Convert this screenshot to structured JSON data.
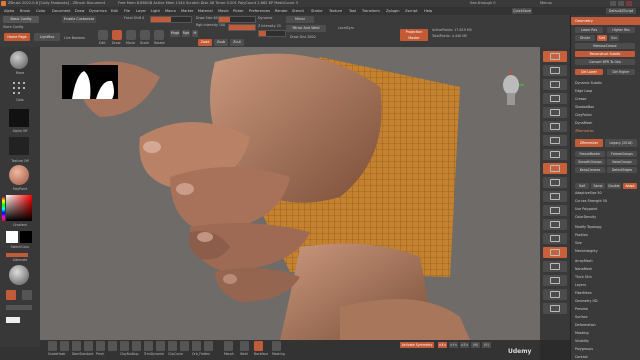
{
  "titlebar": {
    "app": "ZBrush 2022.0.6 [Cody Fanbooks] - ZBrush Document",
    "stats": "Free Mem 8.880GB  Active Mem 1344  Scratch Disk 48  Timer 0.001  PolyCount 2.662 KP  MeshCount 3",
    "quicksave": "QuickSave",
    "see_through": "See-through 0",
    "menus_label": "Menus",
    "default_script": "DefaultZScript"
  },
  "menus": [
    "Alpha",
    "Brush",
    "Color",
    "Document",
    "Draw",
    "Dynamics",
    "Edit",
    "File",
    "Layer",
    "Light",
    "Macro",
    "Marker",
    "Material",
    "Movie",
    "Picker",
    "Preferences",
    "Render",
    "Stencil",
    "Stroke",
    "Texture",
    "Tool",
    "Transform",
    "Zplugin",
    "Zscript",
    "Help"
  ],
  "toolbar": {
    "home_page": "Home Page",
    "lightbox": "LightBox",
    "live_boolean": "Live Boolean",
    "buttons": [
      "Edit",
      "Draw",
      "Move",
      "Scale",
      "Rotate"
    ],
    "mrgb": "Mrgb",
    "rgb": "Rgb",
    "m": "M",
    "zadd": "Zadd",
    "zsub": "Zsub",
    "zcut": "Zcut",
    "focal_shift": "Focal Shift 0",
    "draw_size": "Draw Size 64",
    "dynamic": "Dynamic",
    "rgb_intensity": "Rgb Intensity 100",
    "z_intensity": "Z Intensity 25",
    "mirror": "Mirror",
    "mirror_weld": "Mirror And Weld",
    "draw_dist": "Draw Dist 3000",
    "localsym": "LocalSym",
    "projection_master": "Projection Master",
    "active_points": "ActivePoints: 17.819 Mil",
    "total_points": "TotalPoints: 4.440 Mil",
    "brush_config": "Basic Config",
    "enable_customize": "Enable Customize",
    "store_config": "Store Config",
    "fill_object": "0.001 / 0.001"
  },
  "left_tray": {
    "brush_label": "Move",
    "stroke_label": "Dots",
    "alpha_label": "Alpha Off",
    "texture_label": "Texture Off",
    "material_label": "PolyPaint",
    "gradient_label": "Gradient",
    "switch_color": "SwitchColor",
    "alternate": "Alternate"
  },
  "bottom_bar": {
    "brushes": [
      "SnakeHook",
      "Standard",
      "DamStandard",
      "Move",
      "Pinch",
      "Inflate",
      "ClayBuildup",
      "hPolish",
      "TrimDynamic",
      "SliceCurve",
      "ClipCurve",
      "Orb_Cracks",
      "Orb_Flatten",
      "Smooth"
    ],
    "extra_labels": [
      "Morph",
      "Weld",
      "Backface",
      "Masking"
    ],
    "activate_symmetry": "Activate Symmetry",
    "x": ">X<",
    "y": ">Y<",
    "z": ">Z<",
    "m": "(M)",
    "r": "(R)",
    "udemy": "Udemy"
  },
  "right_shelf": [
    "BPR",
    "SPix 3",
    "Scroll",
    "Zoom",
    "Actual",
    "AAHalf",
    "Persp",
    "Floor",
    "Local",
    "XYZ",
    "Frame",
    "Move",
    "Scale",
    "Rotate",
    "Line Fill",
    "Transp",
    "Ghost",
    "Solo",
    "Xpose"
  ],
  "right_panel": {
    "title": "Geometry",
    "top_items": [
      "Lower Res",
      "Higher Res",
      "Divide",
      "Smt",
      "Suv",
      "ReleaseCrease"
    ],
    "reconstruct": "Reconstruct Subdiv",
    "convert_bpr": "Convert BPR To Geo",
    "del_lower": "Del Lower",
    "del_higher": "Del Higher",
    "sections": [
      "Dynamic Subdiv",
      "Edge Loop",
      "Crease",
      "ShadowBox",
      "ClayPolish",
      "DynaMesh",
      "ZRemesher"
    ],
    "zremesher_btn": "ZRemesher",
    "legacy": "Legacy (2018)",
    "freeze_border": "FreezeBorder",
    "freeze_groups": "FreezeGroups",
    "smooth_groups": "SmoothGroups",
    "keep_groups": "KeepGroups",
    "keep_creases": "KeepCreases",
    "detect_edges": "DetectEdges",
    "half": "Half",
    "same": "Same",
    "double": "Double",
    "adapt": "Adapt",
    "adaptive_size": "AdaptiveSize 50",
    "curves_strength": "Curves Strength 50",
    "use_polypaint": "Use Polypaint",
    "color_density": "ColorDensity",
    "lower_sections": [
      "Modify Topology",
      "Position",
      "Size",
      "MeshIntegrity"
    ],
    "subpanels": [
      "ArrayMesh",
      "NanoMesh",
      "Thick Skin",
      "Layers",
      "FiberMesh",
      "Geometry HD",
      "Preview",
      "Surface",
      "Deformation",
      "Masking",
      "Visibility",
      "Polygroups",
      "Contact"
    ]
  },
  "colors": {
    "accent": "#c25b3a",
    "panel": "#3a3a3a",
    "viewport_bg": "#6e6a67",
    "skin": "#a8765b",
    "cloth": "#c4822f"
  }
}
